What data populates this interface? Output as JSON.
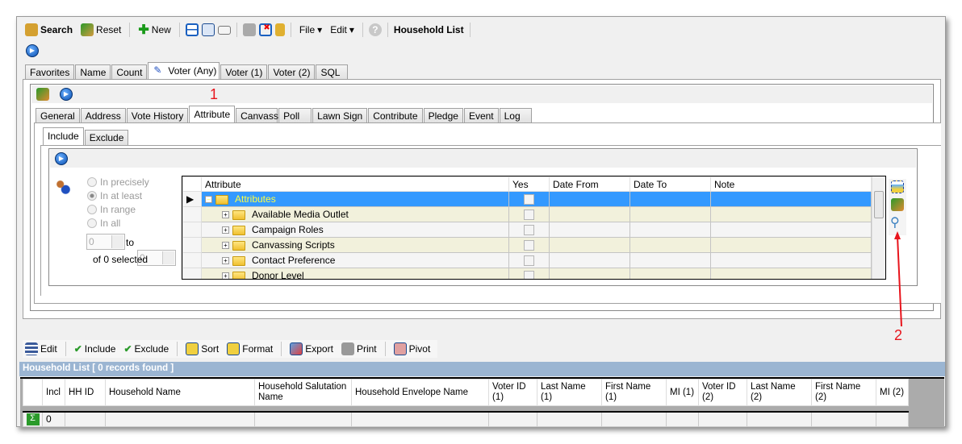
{
  "toolbar": {
    "search": "Search",
    "reset": "Reset",
    "new": "New",
    "file": "File",
    "edit": "Edit",
    "title": "Household List"
  },
  "main_tabs": [
    "Favorites",
    "Name",
    "Count",
    "Voter (Any)",
    "Voter (1)",
    "Voter (2)",
    "SQL"
  ],
  "sub_tabs": [
    "General",
    "Address",
    "Vote History",
    "Attribute",
    "Canvass",
    "Poll",
    "Lawn Sign",
    "Contribute",
    "Pledge",
    "Event",
    "Log"
  ],
  "inc_tabs": [
    "Include",
    "Exclude"
  ],
  "annotations": {
    "one": "1",
    "two": "2",
    "color": "#e8141c"
  },
  "options": {
    "radios": [
      "In precisely",
      "In at least",
      "In range",
      "In all"
    ],
    "selected": "In at least",
    "from": "0",
    "to_label": "to",
    "to": "0",
    "summary": "of 0 selected"
  },
  "attr_grid": {
    "columns": [
      "Attribute",
      "Yes",
      "Date From",
      "Date To",
      "Note"
    ],
    "root": "Attributes",
    "rows": [
      "Available Media Outlet",
      "Campaign Roles",
      "Canvassing Scripts",
      "Contact Preference",
      "Donor Level"
    ]
  },
  "side_icons": [
    "add-column-icon",
    "clear-brush-icon",
    "search-magnifier-icon"
  ],
  "bottom_toolbar": {
    "edit": "Edit",
    "include": "Include",
    "exclude": "Exclude",
    "sort": "Sort",
    "format": "Format",
    "export": "Export",
    "print": "Print",
    "pivot": "Pivot"
  },
  "household": {
    "title": "Household List [ 0 records found ]",
    "bar_color": "#9bb5d2",
    "columns": [
      "Incl",
      "HH ID",
      "Household Name",
      "Household Salutation Name",
      "Household Envelope Name",
      "Voter ID (1)",
      "Last Name (1)",
      "First Name (1)",
      "MI (1)",
      "Voter ID (2)",
      "Last Name (2)",
      "First Name (2)",
      "MI (2)"
    ],
    "footer_incl": "0"
  }
}
